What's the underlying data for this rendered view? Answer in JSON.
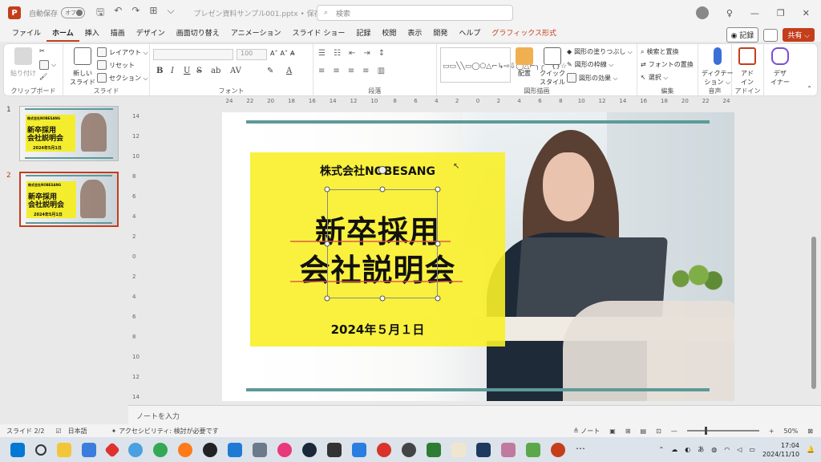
{
  "titlebar": {
    "autosave_label": "自動保存",
    "autosave_state": "オフ",
    "filename": "プレゼン資料サンプル001.pptx • 保存済み ⌵",
    "search_placeholder": "検索"
  },
  "menu": {
    "tabs": [
      "ファイル",
      "ホーム",
      "挿入",
      "描画",
      "デザイン",
      "画面切り替え",
      "アニメーション",
      "スライド ショー",
      "記録",
      "校閲",
      "表示",
      "開発",
      "ヘルプ",
      "グラフィックス形式"
    ],
    "active_tab": "ホーム",
    "record_button": "◉ 記録",
    "share_button": "共有 ⌵"
  },
  "ribbon": {
    "clipboard": {
      "label": "クリップボード",
      "paste": "貼り付け"
    },
    "slides": {
      "label": "スライド",
      "new_slide": "新しい\nスライド",
      "layout": "レイアウト ⌵",
      "reset": "リセット",
      "section": "セクション ⌵"
    },
    "font": {
      "label": "フォント",
      "size": "100",
      "bold": "B",
      "italic": "I",
      "underline": "U",
      "strike": "S",
      "shadow": "ab",
      "spacing": "AV"
    },
    "paragraph": {
      "label": "段落"
    },
    "drawing": {
      "label": "図形描画",
      "arrange": "配置",
      "quick_style": "クイック\nスタイル",
      "fill": "図形の塗りつぶし ⌵",
      "outline": "図形の枠線 ⌵",
      "effects": "図形の効果 ⌵"
    },
    "editing": {
      "label": "編集",
      "find_replace": "検索と置換",
      "font_replace": "フォントの置換",
      "select": "選択 ⌵"
    },
    "voice": {
      "label": "音声",
      "dictate": "ディクテー\nション ⌵"
    },
    "addins": {
      "label": "アドイン",
      "addin": "アド\nイン"
    },
    "designer": {
      "label": "",
      "designer": "デザ\nイナー"
    }
  },
  "thumbnails": [
    {
      "num": "1",
      "company": "株式会社NOBESANG",
      "line1": "新卒採用",
      "line2": "会社説明会",
      "date": "2024年5月1日"
    },
    {
      "num": "2",
      "company": "株式会社NOBESANG",
      "line1": "新卒採用",
      "line2": "会社説明会",
      "date": "2024年5月1日"
    }
  ],
  "ruler": {
    "h": [
      "24",
      "22",
      "20",
      "18",
      "16",
      "14",
      "12",
      "10",
      "8",
      "6",
      "4",
      "2",
      "0",
      "2",
      "4",
      "6",
      "8",
      "10",
      "12",
      "14",
      "16",
      "18",
      "20",
      "22",
      "24"
    ],
    "v": [
      "14",
      "12",
      "10",
      "8",
      "6",
      "4",
      "2",
      "0",
      "2",
      "4",
      "6",
      "8",
      "10",
      "12",
      "14"
    ]
  },
  "slide": {
    "company": "株式会社NOBESANG",
    "title_line1": "新卒採用",
    "title_line2": "会社説明会",
    "date": "2024年５月１日"
  },
  "notes_placeholder": "ノートを入力",
  "status": {
    "slide": "スライド 2/2",
    "language": "日本語",
    "accessibility": "アクセシビリティ: 検討が必要です",
    "notes": "≜ ノート",
    "zoom": "50%"
  },
  "taskbar": {
    "clock_time": "17:04",
    "clock_date": "2024/11/10",
    "ime": "あ"
  },
  "colors": {
    "accent": "#c43e1c",
    "yellow_box": "#f8f028",
    "teal_line": "#5d9a99"
  }
}
